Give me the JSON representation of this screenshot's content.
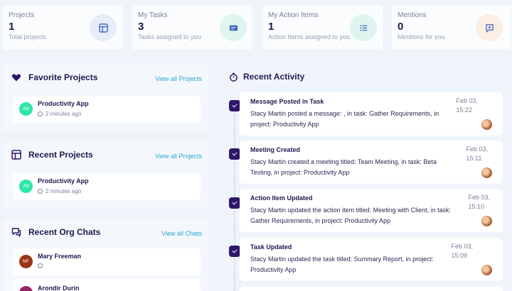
{
  "stats": [
    {
      "label": "Projects",
      "value": "1",
      "sub": "Total projects",
      "icon": "layout-icon",
      "bg": "#e6ecf8"
    },
    {
      "label": "My Tasks",
      "value": "3",
      "sub": "Tasks assigned to you",
      "icon": "tasks-icon",
      "bg": "#dff5ef"
    },
    {
      "label": "My Action Items",
      "value": "1",
      "sub": "Action Items assigned to you",
      "icon": "list-icon",
      "bg": "#dff4ef"
    },
    {
      "label": "Mentions",
      "value": "0",
      "sub": "Mentions for you",
      "icon": "message-icon",
      "bg": "#fbeee2"
    }
  ],
  "favorite": {
    "title": "Favorite Projects",
    "link": "View all Projects",
    "project": {
      "initials": "ZM",
      "name": "Productivity App",
      "time": "2 minutes ago"
    }
  },
  "recent_projects": {
    "title": "Recent Projects",
    "link": "View all Projects",
    "project": {
      "initials": "ZM",
      "name": "Productivity App",
      "time": "2 minutes ago"
    }
  },
  "org_chats": {
    "title": "Recent Org Chats",
    "link": "View all Chats",
    "chats": [
      {
        "initials": "MF",
        "name": "Mary Freeman"
      },
      {
        "initials": "",
        "name": "Arondir Durin"
      }
    ]
  },
  "activity": {
    "title": "Recent Activity",
    "items": [
      {
        "title": "Message Posted in Task",
        "desc": "Stacy Martin posted a message: , in task: Gather Requirements, in project: Productivity App",
        "date": "Feb 03,",
        "time": "15:22"
      },
      {
        "title": "Meeting Created",
        "desc": "Stacy Martin created a meeting titled: Team Meeting, in task: Beta Testing, in project: Productivity App",
        "date": "Feb 03,",
        "time": "15:11"
      },
      {
        "title": "Action Item Updated",
        "desc": "Stacy Martin updated the action item titled: Meeting with Client, in task: Gather Requirements, in project: Productivity App",
        "date": "Feb 03,",
        "time": "15:10"
      },
      {
        "title": "Task Updated",
        "desc": "Stacy Martin updated the task titled: Summary Report, in project: Productivity App",
        "date": "Feb 03,",
        "time": "15:09"
      }
    ]
  },
  "colors": {
    "accent": "#2d1766",
    "link": "#2aa6cf",
    "green_avatar": "#2ee6a6"
  }
}
